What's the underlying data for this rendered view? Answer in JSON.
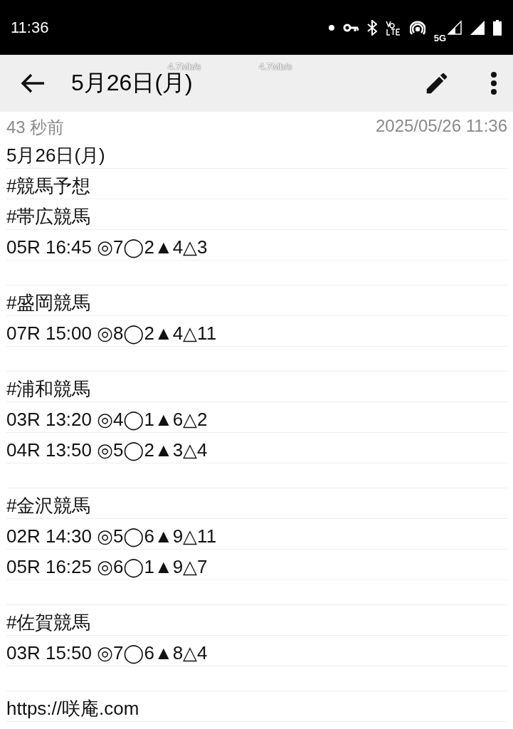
{
  "status_bar": {
    "time": "11:36",
    "network_label": "5G"
  },
  "speed_overlays": [
    "4.7Mb/s",
    "4.7Mb/s"
  ],
  "toolbar": {
    "title": "5月26日(月)"
  },
  "meta": {
    "relative_time": "43 秒前",
    "timestamp": "2025/05/26 11:36"
  },
  "lines": [
    {
      "kind": "text",
      "text": "5月26日(月)"
    },
    {
      "kind": "text",
      "text": "#競馬予想"
    },
    {
      "kind": "text",
      "text": "#帯広競馬"
    },
    {
      "kind": "text",
      "text": "05R 16:45 ◎7◯2▲4△3"
    },
    {
      "kind": "blank"
    },
    {
      "kind": "text",
      "text": "#盛岡競馬"
    },
    {
      "kind": "text",
      "text": "07R 15:00 ◎8◯2▲4△11"
    },
    {
      "kind": "blank"
    },
    {
      "kind": "text",
      "text": "#浦和競馬"
    },
    {
      "kind": "text",
      "text": "03R 13:20 ◎4◯1▲6△2"
    },
    {
      "kind": "text",
      "text": "04R 13:50 ◎5◯2▲3△4"
    },
    {
      "kind": "blank"
    },
    {
      "kind": "text",
      "text": "#金沢競馬"
    },
    {
      "kind": "text",
      "text": "02R 14:30 ◎5◯6▲9△11"
    },
    {
      "kind": "text",
      "text": "05R 16:25 ◎6◯1▲9△7"
    },
    {
      "kind": "blank"
    },
    {
      "kind": "text",
      "text": "#佐賀競馬"
    },
    {
      "kind": "text",
      "text": "03R 15:50 ◎7◯6▲8△4"
    },
    {
      "kind": "blank"
    },
    {
      "kind": "text",
      "text": "https://咲庵.com"
    }
  ]
}
